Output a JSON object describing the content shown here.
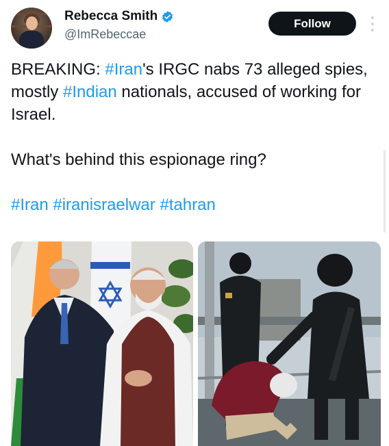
{
  "author": {
    "name": "Rebecca Smith",
    "handle": "@ImRebeccae",
    "verified": true,
    "avatar_icon": "profile-photo"
  },
  "follow_label": "Follow",
  "tweet": {
    "line1": {
      "prefix": "BREAKING: ",
      "tag1": "#Iran",
      "mid1": "'s IRGC nabs 73 alleged spies, mostly ",
      "tag2": "#Indian",
      "suffix": " nationals, accused of working for Israel."
    },
    "question": "What's behind this espionage ring?",
    "hashtags": [
      "#Iran",
      "#iranisraelwar",
      "#tahran"
    ]
  },
  "colors": {
    "link": "#1d9bf0",
    "follow_bg": "#0f1419",
    "verified": "#1d9bf0"
  }
}
